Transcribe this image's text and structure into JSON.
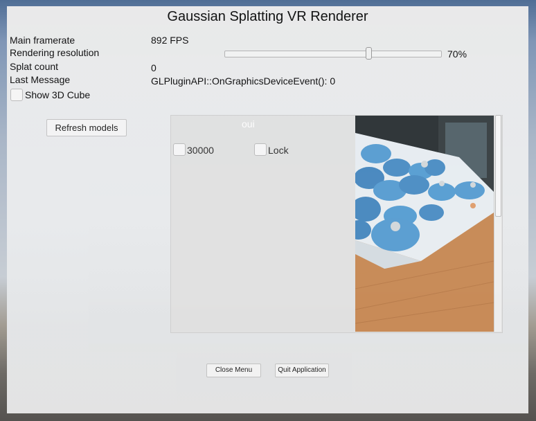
{
  "window": {
    "title": "Gaussian Splatting VR Renderer"
  },
  "stats": {
    "framerate_label": "Main framerate",
    "framerate_value": "892 FPS",
    "resolution_label": "Rendering resolution",
    "resolution_value": "70%",
    "resolution_fraction": 0.67,
    "splat_label": "Splat count",
    "splat_value": "0",
    "message_label": "Last Message",
    "message_value": "GLPluginAPI::OnGraphicsDeviceEvent(): 0"
  },
  "options": {
    "show_cube_label": "Show 3D Cube",
    "show_cube_checked": false
  },
  "models": {
    "refresh_label": "Refresh models",
    "header": "oui",
    "item_label": "30000",
    "lock_label": "Lock"
  },
  "footer": {
    "close_label": "Close Menu",
    "quit_label": "Quit Application"
  },
  "colors": {
    "panel": "#ececec",
    "sky": "#4f6d95",
    "photo_table": "#c88a55",
    "photo_object": "#4f8fc4"
  },
  "icons": [
    "checkbox-icon",
    "slider-thumb-icon",
    "scrollbar-thumb-icon"
  ]
}
